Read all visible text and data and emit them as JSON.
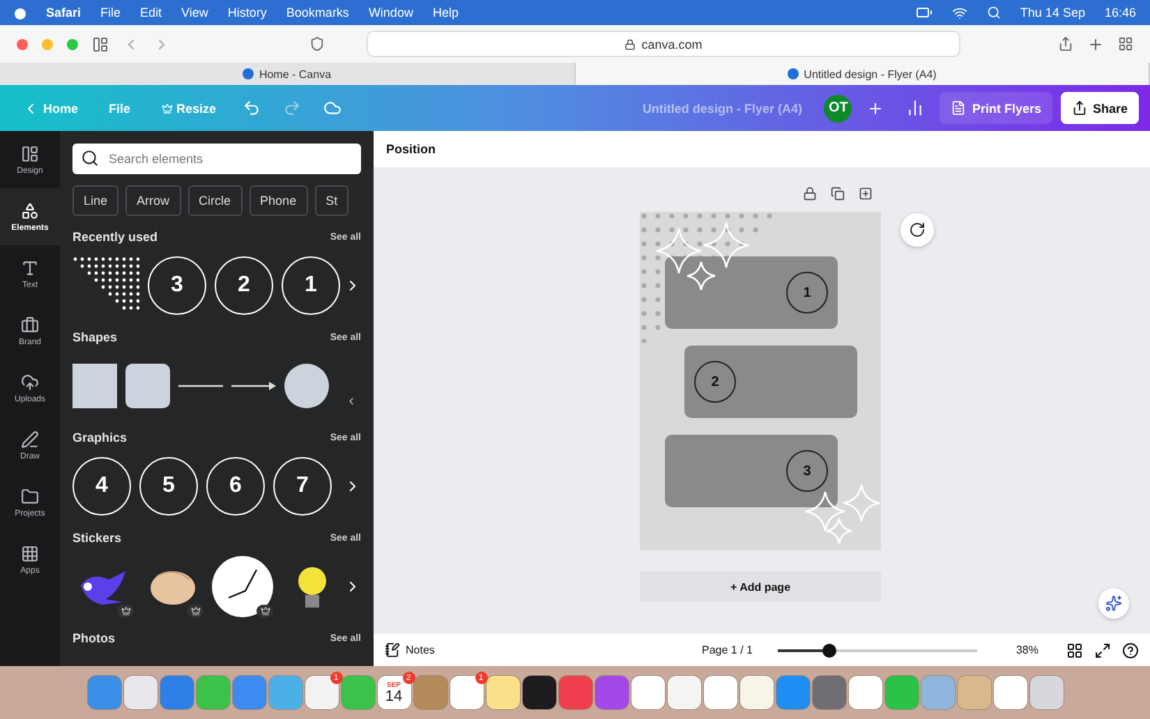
{
  "menubar": {
    "items": [
      "Safari",
      "File",
      "Edit",
      "View",
      "History",
      "Bookmarks",
      "Window",
      "Help"
    ],
    "date": "Thu 14 Sep",
    "time": "16:46"
  },
  "browser": {
    "url": "canva.com",
    "tabs": [
      {
        "label": "Home - Canva",
        "selected": false
      },
      {
        "label": "Untitled design - Flyer (A4)",
        "selected": true
      }
    ]
  },
  "header": {
    "home": "Home",
    "file": "File",
    "resize": "Resize",
    "title": "Untitled design - Flyer (A4)",
    "avatar": "OT",
    "print": "Print Flyers",
    "share": "Share"
  },
  "rail": [
    {
      "label": "Design",
      "selected": false
    },
    {
      "label": "Elements",
      "selected": true
    },
    {
      "label": "Text",
      "selected": false
    },
    {
      "label": "Brand",
      "selected": false
    },
    {
      "label": "Uploads",
      "selected": false
    },
    {
      "label": "Draw",
      "selected": false
    },
    {
      "label": "Projects",
      "selected": false
    },
    {
      "label": "Apps",
      "selected": false
    }
  ],
  "panel": {
    "search": {
      "placeholder": "Search elements"
    },
    "chips": [
      "Line",
      "Arrow",
      "Circle",
      "Phone",
      "St"
    ],
    "sections": [
      {
        "title": "Recently used",
        "see_all": "See all",
        "items": [
          {
            "kind": "dots"
          },
          {
            "kind": "number",
            "label": "3"
          },
          {
            "kind": "number",
            "label": "2"
          },
          {
            "kind": "number",
            "label": "1"
          }
        ]
      },
      {
        "title": "Shapes",
        "see_all": "See all",
        "items": [
          {
            "kind": "square"
          },
          {
            "kind": "rounded"
          },
          {
            "kind": "line"
          },
          {
            "kind": "arrow"
          },
          {
            "kind": "circle"
          }
        ]
      },
      {
        "title": "Graphics",
        "see_all": "See all",
        "items": [
          {
            "kind": "number",
            "label": "4"
          },
          {
            "kind": "number",
            "label": "5"
          },
          {
            "kind": "number",
            "label": "6"
          },
          {
            "kind": "number",
            "label": "7"
          }
        ]
      },
      {
        "title": "Stickers",
        "see_all": "See all",
        "items": [
          {
            "kind": "bird",
            "premium": true
          },
          {
            "kind": "clap",
            "premium": true
          },
          {
            "kind": "clock",
            "premium": true
          },
          {
            "kind": "bulb"
          }
        ]
      },
      {
        "title": "Photos",
        "see_all": "See all"
      }
    ]
  },
  "canvas": {
    "toolbar": "Position",
    "cards": [
      {
        "label": "1"
      },
      {
        "label": "2"
      },
      {
        "label": "3"
      }
    ],
    "add_page": "+ Add page"
  },
  "footer": {
    "notes": "Notes",
    "page": "Page 1 / 1",
    "zoom": {
      "level": 0.26
    },
    "zoom_reading": "38%"
  },
  "dock": [
    {
      "color": "#3a8ee6"
    },
    {
      "color": "#e8e8ec"
    },
    {
      "color": "#2f7fe8"
    },
    {
      "color": "#3ac24a"
    },
    {
      "color": "#3d8bf0"
    },
    {
      "color": "#4bb0e8"
    },
    {
      "color": "#f2f2f2",
      "badge": "1"
    },
    {
      "color": "#3ac24a"
    },
    {
      "color": "#ffffff",
      "kind": "calendar",
      "month": "SEP",
      "day": "14",
      "badge": "2"
    },
    {
      "color": "#b58a5a"
    },
    {
      "color": "#ffffff",
      "badge": "1"
    },
    {
      "color": "#fbe08a"
    },
    {
      "color": "#1c1c1e"
    },
    {
      "color": "#f0404e"
    },
    {
      "color": "#a349e8"
    },
    {
      "color": "#ffffff"
    },
    {
      "color": "#f4f4f4"
    },
    {
      "color": "#ffffff"
    },
    {
      "color": "#f8f4ea"
    },
    {
      "color": "#1e8ef2"
    },
    {
      "color": "#6e6e73"
    },
    {
      "color": "#ffffff"
    },
    {
      "color": "#2bc24a"
    },
    {
      "color": "#8fb6dc"
    },
    {
      "color": "#d9b98c"
    },
    {
      "color": "#ffffff"
    },
    {
      "color": "#d6d8dc"
    }
  ]
}
